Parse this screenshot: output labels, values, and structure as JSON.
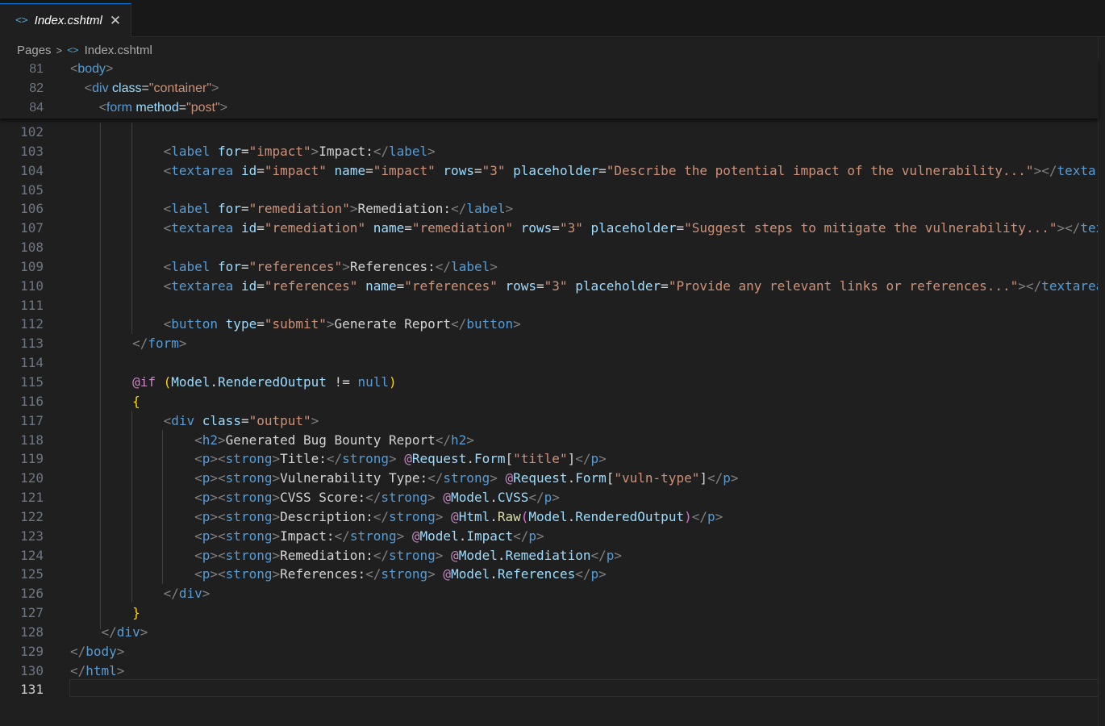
{
  "tab": {
    "label": "Index.cshtml",
    "close": "✕",
    "icon": "<>"
  },
  "breadcrumb": {
    "folder": "Pages",
    "separator": ">",
    "icon": "<>",
    "file": "Index.cshtml"
  },
  "sticky": [
    {
      "n": "81",
      "indent": 0,
      "tokens": [
        [
          "p",
          "<"
        ],
        [
          "t",
          "body"
        ],
        [
          "p",
          ">"
        ]
      ]
    },
    {
      "n": "82",
      "indent": 1,
      "tokens": [
        [
          "p",
          "<"
        ],
        [
          "t",
          "div"
        ],
        [
          "w",
          " "
        ],
        [
          "a",
          "class"
        ],
        [
          "w",
          "="
        ],
        [
          "s",
          "\"container\""
        ],
        [
          "p",
          ">"
        ]
      ]
    },
    {
      "n": "84",
      "indent": 2,
      "tokens": [
        [
          "p",
          "<"
        ],
        [
          "t",
          "form"
        ],
        [
          "w",
          " "
        ],
        [
          "a",
          "method"
        ],
        [
          "w",
          "="
        ],
        [
          "s",
          "\"post\""
        ],
        [
          "p",
          ">"
        ]
      ]
    }
  ],
  "lines": [
    {
      "n": "102",
      "indent": 0,
      "tokens": []
    },
    {
      "n": "103",
      "indent": 3,
      "tokens": [
        [
          "p",
          "<"
        ],
        [
          "t",
          "label"
        ],
        [
          "w",
          " "
        ],
        [
          "a",
          "for"
        ],
        [
          "w",
          "="
        ],
        [
          "s",
          "\"impact\""
        ],
        [
          "p",
          ">"
        ],
        [
          "w",
          "Impact:"
        ],
        [
          "p",
          "</"
        ],
        [
          "t",
          "label"
        ],
        [
          "p",
          ">"
        ]
      ]
    },
    {
      "n": "104",
      "indent": 3,
      "tokens": [
        [
          "p",
          "<"
        ],
        [
          "t",
          "textarea"
        ],
        [
          "w",
          " "
        ],
        [
          "a",
          "id"
        ],
        [
          "w",
          "="
        ],
        [
          "s",
          "\"impact\""
        ],
        [
          "w",
          " "
        ],
        [
          "a",
          "name"
        ],
        [
          "w",
          "="
        ],
        [
          "s",
          "\"impact\""
        ],
        [
          "w",
          " "
        ],
        [
          "a",
          "rows"
        ],
        [
          "w",
          "="
        ],
        [
          "s",
          "\"3\""
        ],
        [
          "w",
          " "
        ],
        [
          "a",
          "placeholder"
        ],
        [
          "w",
          "="
        ],
        [
          "s",
          "\"Describe the potential impact of the vulnerability...\""
        ],
        [
          "p",
          "></"
        ],
        [
          "t",
          "textar"
        ]
      ]
    },
    {
      "n": "105",
      "indent": 0,
      "tokens": []
    },
    {
      "n": "106",
      "indent": 3,
      "tokens": [
        [
          "p",
          "<"
        ],
        [
          "t",
          "label"
        ],
        [
          "w",
          " "
        ],
        [
          "a",
          "for"
        ],
        [
          "w",
          "="
        ],
        [
          "s",
          "\"remediation\""
        ],
        [
          "p",
          ">"
        ],
        [
          "w",
          "Remediation:"
        ],
        [
          "p",
          "</"
        ],
        [
          "t",
          "label"
        ],
        [
          "p",
          ">"
        ]
      ]
    },
    {
      "n": "107",
      "indent": 3,
      "tokens": [
        [
          "p",
          "<"
        ],
        [
          "t",
          "textarea"
        ],
        [
          "w",
          " "
        ],
        [
          "a",
          "id"
        ],
        [
          "w",
          "="
        ],
        [
          "s",
          "\"remediation\""
        ],
        [
          "w",
          " "
        ],
        [
          "a",
          "name"
        ],
        [
          "w",
          "="
        ],
        [
          "s",
          "\"remediation\""
        ],
        [
          "w",
          " "
        ],
        [
          "a",
          "rows"
        ],
        [
          "w",
          "="
        ],
        [
          "s",
          "\"3\""
        ],
        [
          "w",
          " "
        ],
        [
          "a",
          "placeholder"
        ],
        [
          "w",
          "="
        ],
        [
          "s",
          "\"Suggest steps to mitigate the vulnerability...\""
        ],
        [
          "p",
          "></"
        ],
        [
          "t",
          "tex"
        ]
      ]
    },
    {
      "n": "108",
      "indent": 0,
      "tokens": []
    },
    {
      "n": "109",
      "indent": 3,
      "tokens": [
        [
          "p",
          "<"
        ],
        [
          "t",
          "label"
        ],
        [
          "w",
          " "
        ],
        [
          "a",
          "for"
        ],
        [
          "w",
          "="
        ],
        [
          "s",
          "\"references\""
        ],
        [
          "p",
          ">"
        ],
        [
          "w",
          "References:"
        ],
        [
          "p",
          "</"
        ],
        [
          "t",
          "label"
        ],
        [
          "p",
          ">"
        ]
      ]
    },
    {
      "n": "110",
      "indent": 3,
      "tokens": [
        [
          "p",
          "<"
        ],
        [
          "t",
          "textarea"
        ],
        [
          "w",
          " "
        ],
        [
          "a",
          "id"
        ],
        [
          "w",
          "="
        ],
        [
          "s",
          "\"references\""
        ],
        [
          "w",
          " "
        ],
        [
          "a",
          "name"
        ],
        [
          "w",
          "="
        ],
        [
          "s",
          "\"references\""
        ],
        [
          "w",
          " "
        ],
        [
          "a",
          "rows"
        ],
        [
          "w",
          "="
        ],
        [
          "s",
          "\"3\""
        ],
        [
          "w",
          " "
        ],
        [
          "a",
          "placeholder"
        ],
        [
          "w",
          "="
        ],
        [
          "s",
          "\"Provide any relevant links or references...\""
        ],
        [
          "p",
          "></"
        ],
        [
          "t",
          "textarea"
        ]
      ]
    },
    {
      "n": "111",
      "indent": 0,
      "tokens": []
    },
    {
      "n": "112",
      "indent": 3,
      "tokens": [
        [
          "p",
          "<"
        ],
        [
          "t",
          "button"
        ],
        [
          "w",
          " "
        ],
        [
          "a",
          "type"
        ],
        [
          "w",
          "="
        ],
        [
          "s",
          "\"submit\""
        ],
        [
          "p",
          ">"
        ],
        [
          "w",
          "Generate Report"
        ],
        [
          "p",
          "</"
        ],
        [
          "t",
          "button"
        ],
        [
          "p",
          ">"
        ]
      ]
    },
    {
      "n": "113",
      "indent": 2,
      "tokens": [
        [
          "p",
          "</"
        ],
        [
          "t",
          "form"
        ],
        [
          "p",
          ">"
        ]
      ]
    },
    {
      "n": "114",
      "indent": 0,
      "tokens": []
    },
    {
      "n": "115",
      "indent": 2,
      "tokens": [
        [
          "r",
          "@"
        ],
        [
          "r",
          "if"
        ],
        [
          "w",
          " "
        ],
        [
          "y",
          "("
        ],
        [
          "a",
          "Model"
        ],
        [
          "w",
          "."
        ],
        [
          "a",
          "RenderedOutput"
        ],
        [
          "w",
          " != "
        ],
        [
          "k",
          "null"
        ],
        [
          "y",
          ")"
        ]
      ]
    },
    {
      "n": "116",
      "indent": 2,
      "tokens": [
        [
          "y",
          "{"
        ]
      ]
    },
    {
      "n": "117",
      "indent": 3,
      "tokens": [
        [
          "p",
          "<"
        ],
        [
          "t",
          "div"
        ],
        [
          "w",
          " "
        ],
        [
          "a",
          "class"
        ],
        [
          "w",
          "="
        ],
        [
          "s",
          "\"output\""
        ],
        [
          "p",
          ">"
        ]
      ]
    },
    {
      "n": "118",
      "indent": 4,
      "tokens": [
        [
          "p",
          "<"
        ],
        [
          "t",
          "h2"
        ],
        [
          "p",
          ">"
        ],
        [
          "w",
          "Generated Bug Bounty Report"
        ],
        [
          "p",
          "</"
        ],
        [
          "t",
          "h2"
        ],
        [
          "p",
          ">"
        ]
      ]
    },
    {
      "n": "119",
      "indent": 4,
      "tokens": [
        [
          "p",
          "<"
        ],
        [
          "t",
          "p"
        ],
        [
          "p",
          "><"
        ],
        [
          "t",
          "strong"
        ],
        [
          "p",
          ">"
        ],
        [
          "w",
          "Title:"
        ],
        [
          "p",
          "</"
        ],
        [
          "t",
          "strong"
        ],
        [
          "p",
          ">"
        ],
        [
          "w",
          " "
        ],
        [
          "r",
          "@"
        ],
        [
          "a",
          "Request"
        ],
        [
          "w",
          "."
        ],
        [
          "a",
          "Form"
        ],
        [
          "w",
          "["
        ],
        [
          "s",
          "\"title\""
        ],
        [
          "w",
          "]"
        ],
        [
          "p",
          "</"
        ],
        [
          "t",
          "p"
        ],
        [
          "p",
          ">"
        ]
      ]
    },
    {
      "n": "120",
      "indent": 4,
      "tokens": [
        [
          "p",
          "<"
        ],
        [
          "t",
          "p"
        ],
        [
          "p",
          "><"
        ],
        [
          "t",
          "strong"
        ],
        [
          "p",
          ">"
        ],
        [
          "w",
          "Vulnerability Type:"
        ],
        [
          "p",
          "</"
        ],
        [
          "t",
          "strong"
        ],
        [
          "p",
          ">"
        ],
        [
          "w",
          " "
        ],
        [
          "r",
          "@"
        ],
        [
          "a",
          "Request"
        ],
        [
          "w",
          "."
        ],
        [
          "a",
          "Form"
        ],
        [
          "w",
          "["
        ],
        [
          "s",
          "\"vuln-type\""
        ],
        [
          "w",
          "]"
        ],
        [
          "p",
          "</"
        ],
        [
          "t",
          "p"
        ],
        [
          "p",
          ">"
        ]
      ]
    },
    {
      "n": "121",
      "indent": 4,
      "tokens": [
        [
          "p",
          "<"
        ],
        [
          "t",
          "p"
        ],
        [
          "p",
          "><"
        ],
        [
          "t",
          "strong"
        ],
        [
          "p",
          ">"
        ],
        [
          "w",
          "CVSS Score:"
        ],
        [
          "p",
          "</"
        ],
        [
          "t",
          "strong"
        ],
        [
          "p",
          ">"
        ],
        [
          "w",
          " "
        ],
        [
          "r",
          "@"
        ],
        [
          "a",
          "Model"
        ],
        [
          "w",
          "."
        ],
        [
          "a",
          "CVSS"
        ],
        [
          "p",
          "</"
        ],
        [
          "t",
          "p"
        ],
        [
          "p",
          ">"
        ]
      ]
    },
    {
      "n": "122",
      "indent": 4,
      "tokens": [
        [
          "p",
          "<"
        ],
        [
          "t",
          "p"
        ],
        [
          "p",
          "><"
        ],
        [
          "t",
          "strong"
        ],
        [
          "p",
          ">"
        ],
        [
          "w",
          "Description:"
        ],
        [
          "p",
          "</"
        ],
        [
          "t",
          "strong"
        ],
        [
          "p",
          ">"
        ],
        [
          "w",
          " "
        ],
        [
          "r",
          "@"
        ],
        [
          "a",
          "Html"
        ],
        [
          "w",
          "."
        ],
        [
          "f",
          "Raw"
        ],
        [
          "pu",
          "("
        ],
        [
          "a",
          "Model"
        ],
        [
          "w",
          "."
        ],
        [
          "a",
          "RenderedOutput"
        ],
        [
          "pu",
          ")"
        ],
        [
          "p",
          "</"
        ],
        [
          "t",
          "p"
        ],
        [
          "p",
          ">"
        ]
      ]
    },
    {
      "n": "123",
      "indent": 4,
      "tokens": [
        [
          "p",
          "<"
        ],
        [
          "t",
          "p"
        ],
        [
          "p",
          "><"
        ],
        [
          "t",
          "strong"
        ],
        [
          "p",
          ">"
        ],
        [
          "w",
          "Impact:"
        ],
        [
          "p",
          "</"
        ],
        [
          "t",
          "strong"
        ],
        [
          "p",
          ">"
        ],
        [
          "w",
          " "
        ],
        [
          "r",
          "@"
        ],
        [
          "a",
          "Model"
        ],
        [
          "w",
          "."
        ],
        [
          "a",
          "Impact"
        ],
        [
          "p",
          "</"
        ],
        [
          "t",
          "p"
        ],
        [
          "p",
          ">"
        ]
      ]
    },
    {
      "n": "124",
      "indent": 4,
      "tokens": [
        [
          "p",
          "<"
        ],
        [
          "t",
          "p"
        ],
        [
          "p",
          "><"
        ],
        [
          "t",
          "strong"
        ],
        [
          "p",
          ">"
        ],
        [
          "w",
          "Remediation:"
        ],
        [
          "p",
          "</"
        ],
        [
          "t",
          "strong"
        ],
        [
          "p",
          ">"
        ],
        [
          "w",
          " "
        ],
        [
          "r",
          "@"
        ],
        [
          "a",
          "Model"
        ],
        [
          "w",
          "."
        ],
        [
          "a",
          "Remediation"
        ],
        [
          "p",
          "</"
        ],
        [
          "t",
          "p"
        ],
        [
          "p",
          ">"
        ]
      ]
    },
    {
      "n": "125",
      "indent": 4,
      "tokens": [
        [
          "p",
          "<"
        ],
        [
          "t",
          "p"
        ],
        [
          "p",
          "><"
        ],
        [
          "t",
          "strong"
        ],
        [
          "p",
          ">"
        ],
        [
          "w",
          "References:"
        ],
        [
          "p",
          "</"
        ],
        [
          "t",
          "strong"
        ],
        [
          "p",
          ">"
        ],
        [
          "w",
          " "
        ],
        [
          "r",
          "@"
        ],
        [
          "a",
          "Model"
        ],
        [
          "w",
          "."
        ],
        [
          "a",
          "References"
        ],
        [
          "p",
          "</"
        ],
        [
          "t",
          "p"
        ],
        [
          "p",
          ">"
        ]
      ]
    },
    {
      "n": "126",
      "indent": 3,
      "tokens": [
        [
          "p",
          "</"
        ],
        [
          "t",
          "div"
        ],
        [
          "p",
          ">"
        ]
      ]
    },
    {
      "n": "127",
      "indent": 2,
      "tokens": [
        [
          "y",
          "}"
        ]
      ]
    },
    {
      "n": "128",
      "indent": 1,
      "tokens": [
        [
          "p",
          "</"
        ],
        [
          "t",
          "div"
        ],
        [
          "p",
          ">"
        ]
      ]
    },
    {
      "n": "129",
      "indent": 0,
      "tokens": [
        [
          "p",
          "</"
        ],
        [
          "t",
          "body"
        ],
        [
          "p",
          ">"
        ]
      ]
    },
    {
      "n": "130",
      "indent": 0,
      "tokens": [
        [
          "p",
          "</"
        ],
        [
          "t",
          "html"
        ],
        [
          "p",
          ">"
        ]
      ]
    },
    {
      "n": "131",
      "indent": 0,
      "tokens": [],
      "active": true
    }
  ]
}
